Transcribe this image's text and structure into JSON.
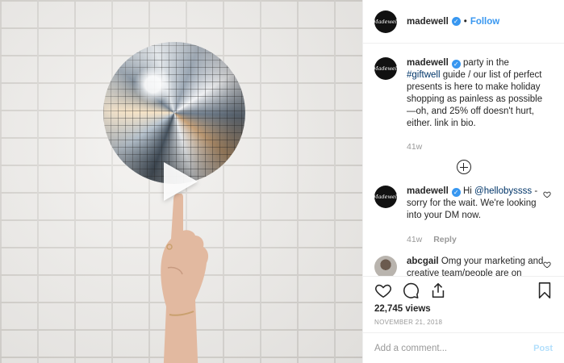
{
  "account": {
    "avatar_text": "Madewell",
    "username": "madewell",
    "separator": "•",
    "follow_label": "Follow"
  },
  "caption": {
    "username": "madewell",
    "text_before": " party in the ",
    "hashtag": "#giftwell",
    "text_after": " guide / our list of perfect presents is here to make holiday shopping as painless as possible—oh, and 25% off doesn't hurt, either. link in bio.",
    "time": "41w"
  },
  "comments": [
    {
      "username": "madewell",
      "prefix": " Hi ",
      "mention": "@hellobyssss",
      "text": " - sorry for the wait. We're looking into your DM now.",
      "time": "41w",
      "reply_label": "Reply"
    },
    {
      "username": "abcgail",
      "text": " Omg your marketing and creative team/people are on point with this haha 👏🏽👏🏽👏🏽"
    }
  ],
  "stats": {
    "views": "22,745 views",
    "date": "NOVEMBER 21, 2018"
  },
  "composer": {
    "placeholder": "Add a comment...",
    "post_label": "Post"
  },
  "icons": {
    "like": "heart-icon",
    "comment": "comment-icon",
    "share": "share-icon",
    "save": "bookmark-icon",
    "load_more": "plus-circle-icon",
    "play": "play-icon"
  },
  "colors": {
    "accent": "#3897f0",
    "link": "#003569",
    "muted": "#999999",
    "post_disabled": "#b2dffc"
  }
}
